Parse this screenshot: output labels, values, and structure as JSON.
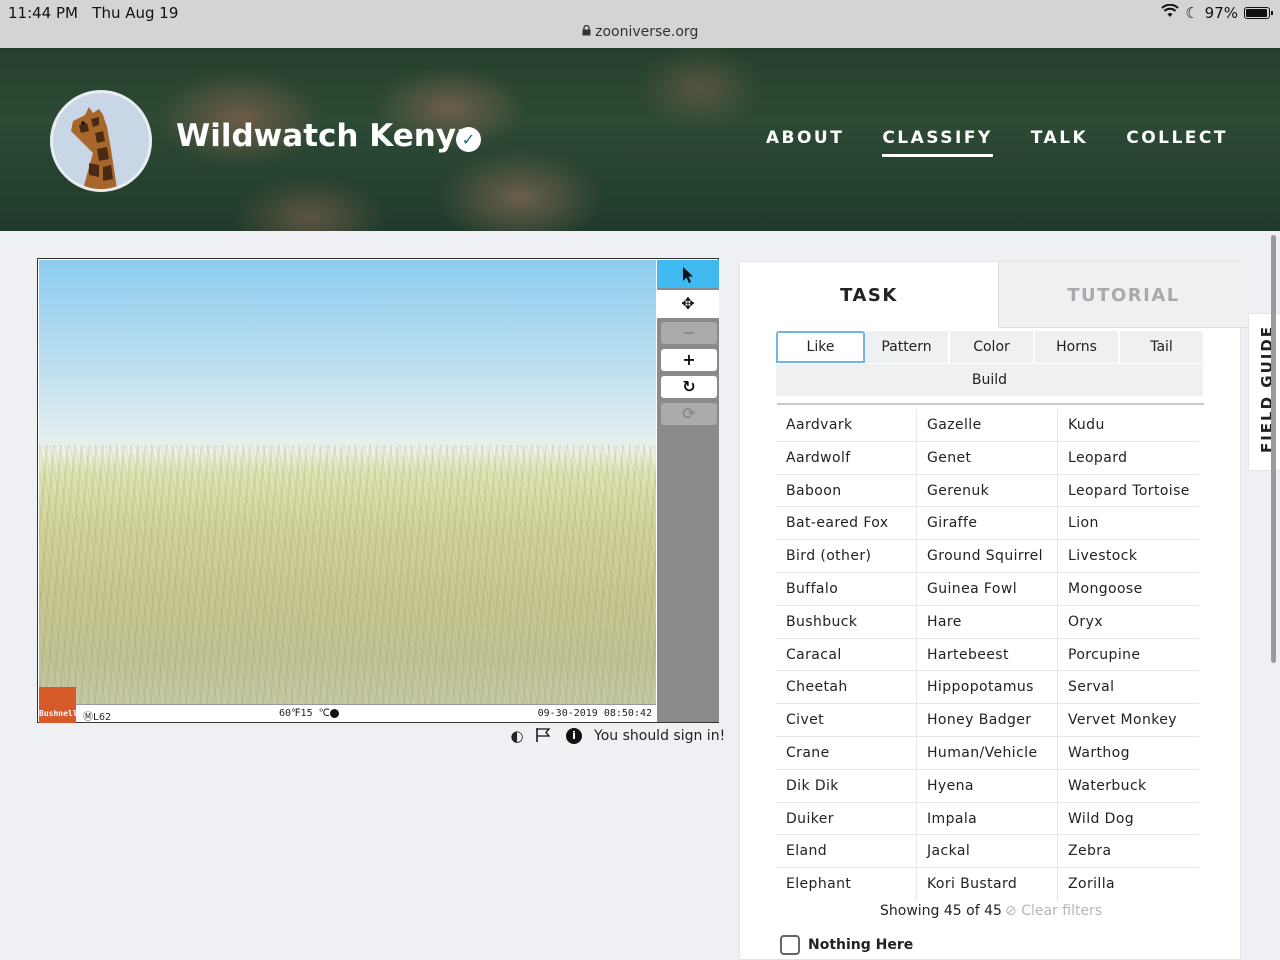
{
  "status_bar": {
    "time": "11:44 PM",
    "date": "Thu Aug 19",
    "battery": "97%",
    "url": "zooniverse.org"
  },
  "header": {
    "title": "Wildwatch Kenya",
    "nav": [
      "ABOUT",
      "CLASSIFY",
      "TALK",
      "COLLECT"
    ],
    "active_nav": "CLASSIFY"
  },
  "viewer": {
    "brand": "Bushnell",
    "camera_id": "ⓂL62",
    "temperature": "60℉15 ℃",
    "timestamp": "09-30-2019 08:50:42",
    "sign_in_message": "You should sign in!"
  },
  "tabs": {
    "task": "TASK",
    "tutorial": "TUTORIAL"
  },
  "filters": {
    "row1": [
      "Like",
      "Pattern",
      "Color",
      "Horns",
      "Tail"
    ],
    "row2": [
      "Build"
    ],
    "active": "Like"
  },
  "species": [
    [
      "Aardvark",
      "Gazelle",
      "Kudu"
    ],
    [
      "Aardwolf",
      "Genet",
      "Leopard"
    ],
    [
      "Baboon",
      "Gerenuk",
      "Leopard Tortoise"
    ],
    [
      "Bat-eared Fox",
      "Giraffe",
      "Lion"
    ],
    [
      "Bird (other)",
      "Ground Squirrel",
      "Livestock"
    ],
    [
      "Buffalo",
      "Guinea Fowl",
      "Mongoose"
    ],
    [
      "Bushbuck",
      "Hare",
      "Oryx"
    ],
    [
      "Caracal",
      "Hartebeest",
      "Porcupine"
    ],
    [
      "Cheetah",
      "Hippopotamus",
      "Serval"
    ],
    [
      "Civet",
      "Honey Badger",
      "Vervet Monkey"
    ],
    [
      "Crane",
      "Human/Vehicle",
      "Warthog"
    ],
    [
      "Dik Dik",
      "Hyena",
      "Waterbuck"
    ],
    [
      "Duiker",
      "Impala",
      "Wild Dog"
    ],
    [
      "Eland",
      "Jackal",
      "Zebra"
    ],
    [
      "Elephant",
      "Kori Bustard",
      "Zorilla"
    ]
  ],
  "showing": "Showing 45 of 45",
  "clear_filters": "Clear filters",
  "nothing_here": "Nothing Here",
  "field_guide": "FIELD GUIDE",
  "colors": {
    "accent_blue": "#40b8f0",
    "filter_border": "#6fb6e6",
    "verified_teal": "#1b6b7a"
  }
}
